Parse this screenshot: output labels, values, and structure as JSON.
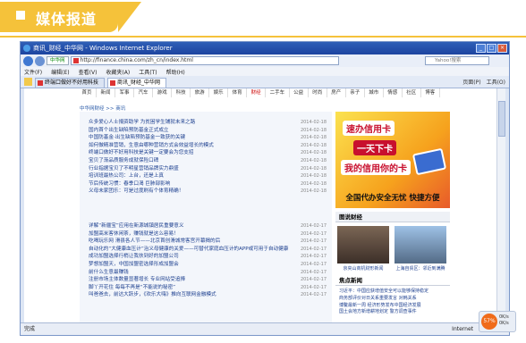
{
  "banner": {
    "title": "媒体报道"
  },
  "browser": {
    "window_title": "商讯_财经_中华网 - Windows Internet Explorer",
    "address": {
      "chip": "中华网",
      "url": "http://finance.china.com/zh_cn/index.html",
      "search_placeholder": "Yahoo!搜索"
    },
    "menu": [
      "文件(F)",
      "编辑(E)",
      "查看(V)",
      "收藏夹(A)",
      "工具(T)",
      "帮助(H)"
    ],
    "tabs": [
      {
        "label": "终端口做好不好用科技"
      },
      {
        "label": "商讯_财经_中华网"
      }
    ],
    "tab_tools": [
      "页面(P)",
      "工具(O)"
    ],
    "status": {
      "left": "完成",
      "zone": "Internet"
    }
  },
  "site": {
    "nav": [
      "首页",
      "新闻",
      "军事",
      "汽车",
      "游戏",
      "科技",
      "旅游",
      "娱乐",
      "体育",
      "财经",
      "二手车",
      "公益",
      "时尚",
      "房产",
      "亲子",
      "城市",
      "情感",
      "社区",
      "博客"
    ],
    "nav_current": "财经",
    "breadcrumb": "中华网财经 >> 商讯",
    "news1": [
      {
        "t": "众多爱心人士捐资助学 为贫困学生铺就未来之路",
        "d": "2014-02-18"
      },
      {
        "t": "国内首个出生缺陷预防基金正式成立",
        "d": "2014-02-18"
      },
      {
        "t": "中国防基金·出生缺陷预防基金一致获的关键",
        "d": "2014-02-18"
      },
      {
        "t": "如何做精准营销，生意由哪种营销方式会效益增长的模式",
        "d": "2014-02-18"
      },
      {
        "t": "终端口做好不好用科技是关键一定要会为您支招",
        "d": "2014-02-18"
      },
      {
        "t": "宝贝了渐品质服务成就保险口碑",
        "d": "2014-02-18"
      },
      {
        "t": "行业指据宝贝了不明星营销品牌实力鼎盛",
        "d": "2014-02-18"
      },
      {
        "t": "培训班最热公司：上台，还是上真",
        "d": "2014-02-18"
      },
      {
        "t": "节后传统习惯：春季口渴 巨肺部影响",
        "d": "2014-02-18"
      },
      {
        "t": "义母未家团乐：可是过度刷有个体育精确！",
        "d": "2014-02-18"
      }
    ],
    "news2": [
      {
        "t": "详解“新疆宝”应用在新源城镇居民重要意义",
        "d": "2014-02-17"
      },
      {
        "t": "加盟高米客休闲茶，赚钱就是这么容易！",
        "d": "2014-02-17"
      },
      {
        "t": "吃喝玩乐网 滑县各人节——北京首创滑城常客宫开幕揭的后",
        "d": "2014-02-17"
      },
      {
        "t": "自动化的“大健康血压计”治义母健康的关爱——可替代家庭血压计的APP或可用于自动健康",
        "d": "2014-02-17"
      },
      {
        "t": "成功加盟选择行梢让我扶到好的加盟公司",
        "d": "2014-02-17"
      },
      {
        "t": "梦想加盟天，中国加盟密选择形成加盟会",
        "d": "2014-02-17"
      },
      {
        "t": "前什么生意最赚钱",
        "d": "2014-02-17"
      },
      {
        "t": "注册市场主体数量显著增长 专业网站受追捧",
        "d": "2014-02-17"
      },
      {
        "t": "脚丫开花住 每每不再是“不能说的秘密”",
        "d": "2014-02-17"
      },
      {
        "t": "叫爸爸去，前达大跃步，《欢乐大嗨》推向互联网金融模式",
        "d": "2014-02-17"
      }
    ],
    "ad": {
      "line1": "速办信用卡",
      "line2": "一天下卡",
      "line3": "我的信用你的卡",
      "slogan": "全国代办安全无忧 快捷方便"
    },
    "pics_title": "图说财经",
    "pics": [
      {
        "caption": "京央山商机财形新闻"
      },
      {
        "caption": "上海自贸区：邻近到满腾"
      }
    ],
    "focus_title": "焦点新闻",
    "focus": [
      "习近平：中国应获增值安全可以能够保持稳定",
      "商务部评价对日关系重要发言 对韩关系",
      "博鳌最新一周 经济形势发布中国经济发展",
      "国土会地方新增耕地划定 警方调查事件"
    ],
    "float": {
      "pct": "57%",
      "up": "0K/s",
      "down": "0K/s"
    }
  },
  "colors": {
    "banner": "#f5c23a",
    "link": "#1c3f8f",
    "nav_current": "#cc0000"
  }
}
